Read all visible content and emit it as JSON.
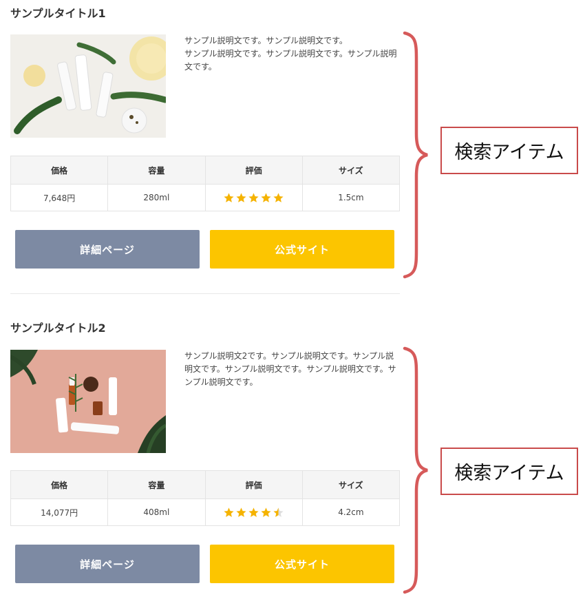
{
  "items": [
    {
      "title": "サンプルタイトル1",
      "description": "サンプル説明文です。サンプル説明文です。\nサンプル説明文です。サンプル説明文です。サンプル説明文です。",
      "spec_headers": [
        "価格",
        "容量",
        "評価",
        "サイズ"
      ],
      "price": "7,648円",
      "volume": "280ml",
      "rating": 5,
      "size": "1.5cm",
      "detail_button": "詳細ページ",
      "official_button": "公式サイト"
    },
    {
      "title": "サンプルタイトル2",
      "description": "サンプル説明文2です。サンプル説明文です。サンプル説明文です。サンプル説明文です。サンプル説明文です。サンプル説明文です。",
      "spec_headers": [
        "価格",
        "容量",
        "評価",
        "サイズ"
      ],
      "price": "14,077円",
      "volume": "408ml",
      "rating": 4.5,
      "size": "4.2cm",
      "detail_button": "詳細ページ",
      "official_button": "公式サイト"
    }
  ],
  "annotations": [
    {
      "label": "検索アイテム"
    },
    {
      "label": "検索アイテム"
    }
  ],
  "colors": {
    "detail_button": "#7d8aa3",
    "official_button": "#fcc500",
    "star": "#f5b301",
    "brace": "#d65a5a"
  }
}
